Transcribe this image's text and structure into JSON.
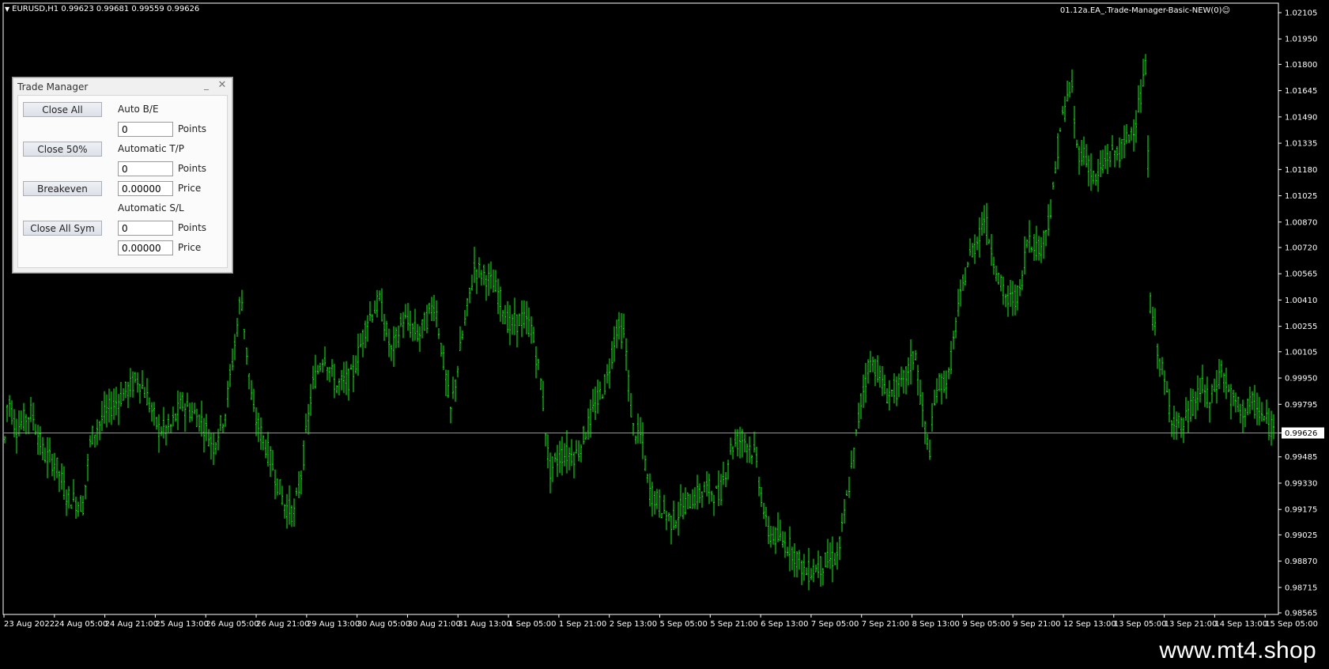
{
  "chart": {
    "symbol_info": "EURUSD,H1  0.99623 0.99681 0.99559 0.99626",
    "expert_label": "01.12a.EA_.Trade-Manager-Basic-NEW(0)",
    "smiley": "☺",
    "current_price": "0.99626",
    "price_labels": [
      "1.02105",
      "1.01950",
      "1.01800",
      "1.01645",
      "1.01490",
      "1.01335",
      "1.01180",
      "1.01025",
      "1.00870",
      "1.00720",
      "1.00565",
      "1.00410",
      "1.00255",
      "1.00105",
      "0.99950",
      "0.99795",
      "0.99626",
      "0.99485",
      "0.99330",
      "0.99175",
      "0.99025",
      "0.98870",
      "0.98715",
      "0.98565"
    ],
    "time_labels": [
      "23 Aug 2022",
      "24 Aug 05:00",
      "24 Aug 21:00",
      "25 Aug 13:00",
      "26 Aug 05:00",
      "26 Aug 21:00",
      "29 Aug 13:00",
      "30 Aug 05:00",
      "30 Aug 21:00",
      "31 Aug 13:00",
      "1 Sep 05:00",
      "1 Sep 21:00",
      "2 Sep 13:00",
      "5 Sep 05:00",
      "5 Sep 21:00",
      "6 Sep 13:00",
      "7 Sep 05:00",
      "7 Sep 21:00",
      "8 Sep 13:00",
      "9 Sep 05:00",
      "9 Sep 21:00",
      "12 Sep 13:00",
      "13 Sep 05:00",
      "13 Sep 21:00",
      "14 Sep 13:00",
      "15 Sep 05:00"
    ],
    "colors": {
      "background": "#000000",
      "bars": "#00ff00",
      "price_line": "#7f9bb0",
      "axis": "#ffffff"
    }
  },
  "panel": {
    "title": "Trade Manager",
    "buttons": {
      "close_all": "Close All",
      "close_50": "Close 50%",
      "breakeven": "Breakeven",
      "close_all_sym": "Close All Sym"
    },
    "labels": {
      "auto_be": "Auto B/E",
      "auto_tp": "Automatic T/P",
      "auto_sl": "Automatic S/L",
      "points": "Points",
      "price": "Price"
    },
    "inputs": {
      "be_points": "0",
      "tp_points": "0",
      "be_price": "0.00000",
      "sl_points": "0",
      "sl_price": "0.00000"
    }
  },
  "watermark": "www.mt4.shop"
}
